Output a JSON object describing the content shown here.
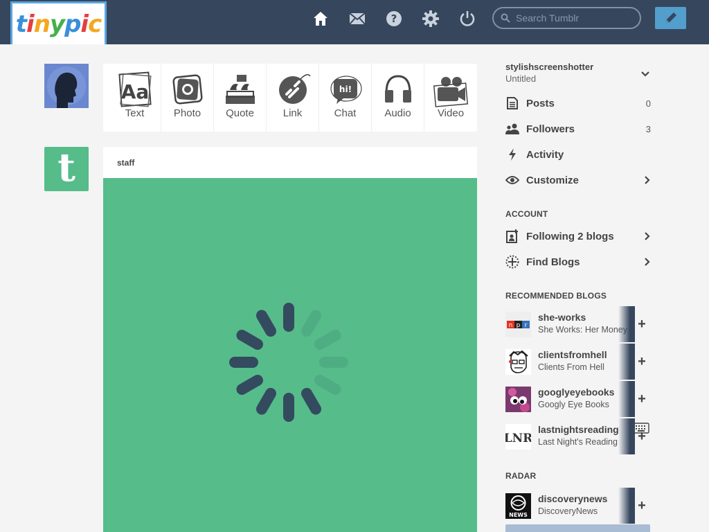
{
  "header": {
    "logo_text": "tinypic",
    "search_placeholder": "Search Tumblr",
    "nav_icons": [
      "home-icon",
      "mail-icon",
      "help-icon",
      "gear-icon",
      "power-icon"
    ],
    "compose_icon": "pencil-icon"
  },
  "post_types": [
    {
      "label": "Text",
      "icon": "text-post-icon"
    },
    {
      "label": "Photo",
      "icon": "camera-icon"
    },
    {
      "label": "Quote",
      "icon": "quote-icon"
    },
    {
      "label": "Link",
      "icon": "link-icon"
    },
    {
      "label": "Chat",
      "icon": "chat-icon"
    },
    {
      "label": "Audio",
      "icon": "headphones-icon"
    },
    {
      "label": "Video",
      "icon": "video-camera-icon"
    }
  ],
  "post": {
    "author": "staff",
    "media_color": "#56bc8a"
  },
  "sidebar": {
    "blog_name": "stylishscreenshotter",
    "blog_title": "Untitled",
    "items": [
      {
        "label": "Posts",
        "count": "0"
      },
      {
        "label": "Followers",
        "count": "3"
      },
      {
        "label": "Activity"
      },
      {
        "label": "Customize"
      }
    ],
    "account_title": "ACCOUNT",
    "account_items": [
      {
        "label": "Following 2 blogs"
      },
      {
        "label": "Find Blogs"
      }
    ],
    "recommended_title": "RECOMMENDED BLOGS",
    "recommended": [
      {
        "name": "she-works",
        "desc": "She Works: Her Money"
      },
      {
        "name": "clientsfromhell",
        "desc": "Clients From Hell"
      },
      {
        "name": "googlyeyebooks",
        "desc": "Googly Eye Books"
      },
      {
        "name": "lastnightsreading",
        "desc": "Last Night's Reading"
      }
    ],
    "radar_title": "RADAR",
    "radar": [
      {
        "name": "discoverynews",
        "desc": "DiscoveryNews"
      }
    ]
  },
  "colors": {
    "topbar": "#36465d",
    "accent": "#529ecc",
    "tumblr_green": "#56bc8a",
    "page_bg": "#f4f4f4"
  }
}
